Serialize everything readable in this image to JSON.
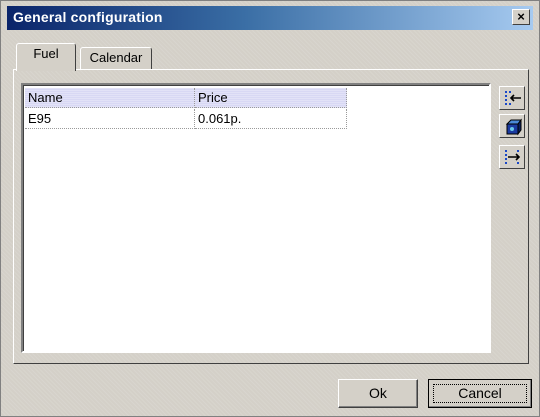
{
  "window": {
    "title": "General configuration",
    "close_glyph": "×"
  },
  "tabs": [
    {
      "label": "Fuel",
      "selected": true
    },
    {
      "label": "Calendar",
      "selected": false
    }
  ],
  "grid": {
    "columns": [
      "Name",
      "Price"
    ],
    "rows": [
      [
        "E95",
        "0.061p."
      ]
    ]
  },
  "side_buttons": [
    {
      "icon": "insert-row-icon"
    },
    {
      "icon": "delete-row-icon"
    },
    {
      "icon": "append-row-icon"
    }
  ],
  "buttons": {
    "ok_label": "Ok",
    "cancel_label": "Cancel"
  },
  "colors": {
    "title_start": "#0a246a",
    "title_end": "#a6caf0",
    "face": "#d4d0c8",
    "grid_header": "#d8d8f4"
  }
}
